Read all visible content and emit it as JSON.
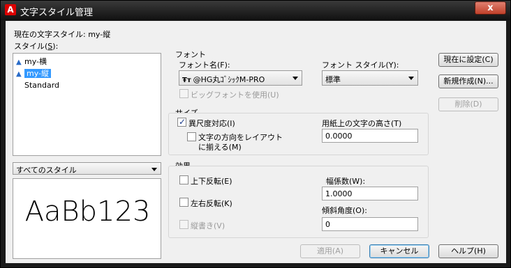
{
  "window": {
    "title": "文字スタイル管理",
    "app_icon": "A",
    "close": "x"
  },
  "current_style_label": "現在の文字スタイル: my-縦",
  "styles_label_pre": "スタイル(",
  "styles_label_key": "S",
  "styles_label_post": "):",
  "styles": [
    {
      "name": "my-横",
      "icon": "annotative-icon",
      "selected": false
    },
    {
      "name": "my-縦",
      "icon": "annotative-icon",
      "selected": true
    },
    {
      "name": "Standard",
      "icon": "",
      "selected": false
    }
  ],
  "filter": {
    "value": "すべてのスタイル"
  },
  "preview_text": "AaBb123",
  "font": {
    "group_label": "フォント",
    "name_label": "フォント名(F):",
    "name_value": "@HG丸ｺﾞｼｯｸM-PRO",
    "style_label": "フォント スタイル(Y):",
    "style_value": "標準",
    "bigfont_label": "ビッグフォントを使用(U)",
    "bigfont_checked": false
  },
  "size": {
    "group_label": "サイズ",
    "annotative_label": "異尺度対応(I)",
    "annotative_checked": true,
    "match_layout_label_1": "文字の方向をレイアウト",
    "match_layout_label_2": "に揃える(M)",
    "match_layout_checked": false,
    "paper_height_label": "用紙上の文字の高さ(T)",
    "paper_height_value": "0.0000"
  },
  "effects": {
    "group_label": "効果",
    "upside_down_label": "上下反転(E)",
    "backwards_label": "左右反転(K)",
    "vertical_label": "縦書き(V)",
    "width_factor_label": "幅係数(W):",
    "width_factor_value": "1.0000",
    "oblique_label": "傾斜角度(O):",
    "oblique_value": "0"
  },
  "buttons": {
    "set_current": "現在に設定(C)",
    "new": "新規作成(N)...",
    "delete": "削除(D)",
    "apply": "適用(A)",
    "cancel": "キャンセル",
    "help": "ヘルプ(H)"
  }
}
